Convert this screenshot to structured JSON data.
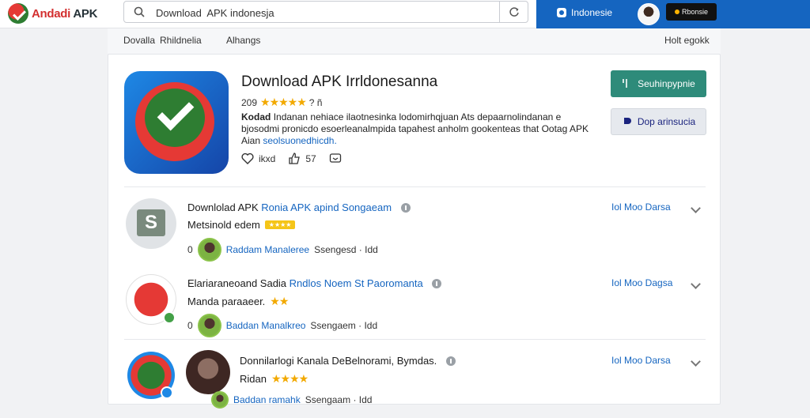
{
  "topbar": {
    "logo_a": "Andadi",
    "logo_b": "APK",
    "search_value": "Download  APK indonesja",
    "blue_item": "Indonesie",
    "dark_btn": "Rbonsie"
  },
  "subnav": {
    "item1": "Dovalla",
    "item2": "Rhildnelia",
    "item3": "Alhangs",
    "right": "Holt egokk"
  },
  "app": {
    "title": "Download APK Irrldonesanna",
    "rating_prefix": "209",
    "stars": "★★★★★",
    "rating_suffix": "? ñ",
    "desc_bold": "Kodad",
    "desc": "Indanan nehiace ilaotnesinka lodomirhqjuan Ats depaarnolindanan e bjosodmi pronicdo esoerleanalmpida tapahest anholm gookenteas that Ootag APK Aian",
    "desc_link": "seolsuonedhicdh.",
    "like_label": "ikxd",
    "share_count": "57",
    "primary_btn": "Seuhinpypnie",
    "secondary_btn": "Dop arinsucia"
  },
  "rows": [
    {
      "title": "Downlolad APK",
      "title_hl": "Ronia APK apind Songaeam",
      "sub": "Metsinold edem",
      "badge": "★★★★",
      "meta_prefix": "0",
      "meta_blue": "Raddam Manaleree",
      "meta_rest": "Ssengesd · Idd",
      "link": "Iol Moo Darsa"
    },
    {
      "title": "Elariaraneoand Sadia",
      "title_hl": "Rndlos Noem St Paoromanta",
      "sub": "Manda paraaeer.",
      "badge": "★★",
      "meta_prefix": "0",
      "meta_blue": "Baddan Manalkreo",
      "meta_rest": "Ssengaem · Idd",
      "link": "Iol Moo Dagsa"
    },
    {
      "title": "Donnilarlogi Kanala DeBelnorami, Bymdas.",
      "title_hl": "",
      "sub": "Ridan",
      "badge": "★★★★",
      "meta_prefix": "",
      "meta_blue": "Baddan ramahk",
      "meta_rest": "Ssengaam · Idd",
      "link": "Iol Moo Darsa"
    }
  ],
  "colors": {
    "brand_blue": "#1565c0",
    "primary_green": "#2e8b7a",
    "star": "#f2a900"
  }
}
